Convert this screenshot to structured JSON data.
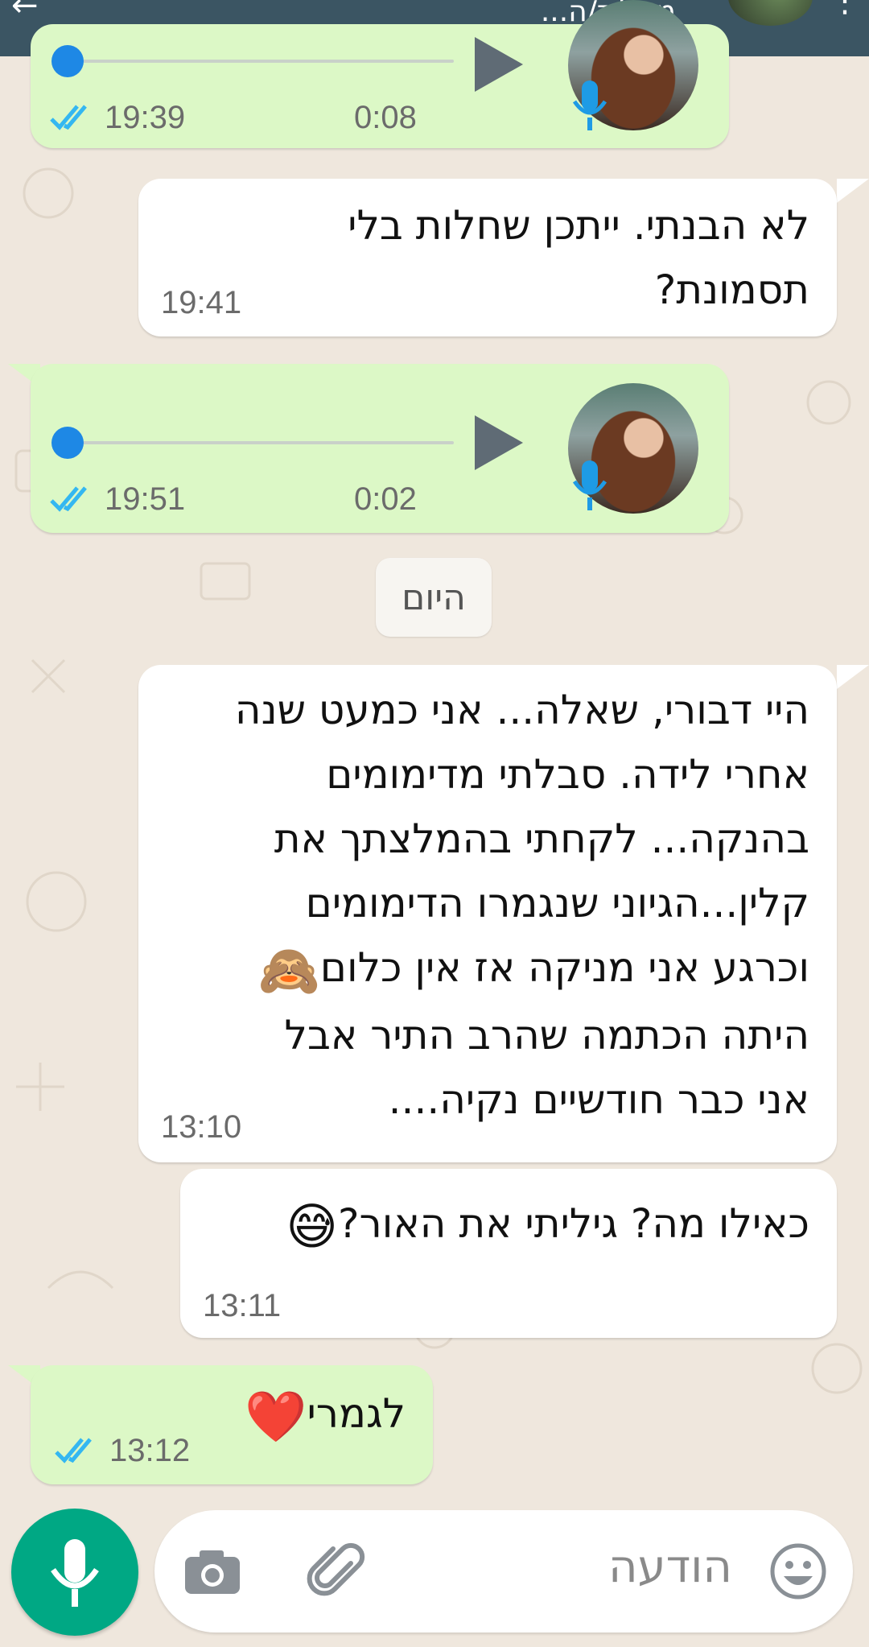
{
  "header": {
    "status_text": "מקליד/ה..."
  },
  "messages": [
    {
      "kind": "voice",
      "dir": "out",
      "duration": "0:08",
      "time": "19:39",
      "progress": 0
    },
    {
      "kind": "text",
      "dir": "in",
      "lines": [
        "לא הבנתי. ייתכן שחלות בלי",
        "תסמונת?"
      ],
      "time": "19:41"
    },
    {
      "kind": "voice",
      "dir": "out",
      "duration": "0:02",
      "time": "19:51",
      "progress": 0
    },
    {
      "kind": "text",
      "dir": "in",
      "lines": [
        "היי דבורי, שאלה... אני כמעט שנה",
        "אחרי לידה. סבלתי מדימומים",
        "בהנקה... לקחתי בהמלצתך את",
        "קלין...הגיוני שנגמרו הדימומים",
        "וכרגע אני מניקה אז אין כלום",
        "היתה הכתמה שהרב התיר אבל",
        "אני כבר חודשיים נקיה...."
      ],
      "emoji": "🙈",
      "time": "13:10"
    },
    {
      "kind": "text",
      "dir": "in",
      "lines": [
        "כאילו מה? גיליתי את האור?"
      ],
      "emoji": "😅",
      "time": "13:11"
    },
    {
      "kind": "text",
      "dir": "out",
      "lines": [
        "לגמרי"
      ],
      "emoji": "❤️",
      "time": "13:12"
    }
  ],
  "day_separator": "היום",
  "composer": {
    "placeholder": "הודעה",
    "emoji_icon": "emoji-smiley-icon",
    "attach_icon": "paperclip-icon",
    "camera_icon": "camera-icon",
    "mic_icon": "microphone-icon"
  },
  "colors": {
    "header": "#3b5563",
    "outgoing": "#dcf8c6",
    "incoming": "#ffffff",
    "read_ticks": "#34b7f1",
    "fab": "#00a884"
  }
}
